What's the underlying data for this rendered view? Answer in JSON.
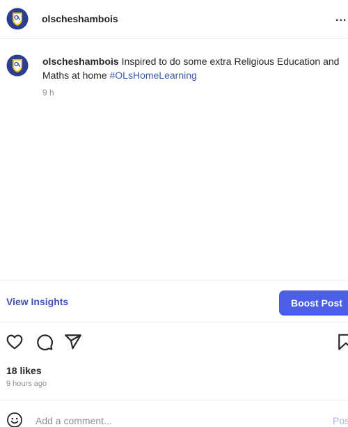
{
  "post": {
    "username": "olscheshambois",
    "more_label": "...",
    "colors": {
      "accent": "#4a5ee8",
      "link": "#3f51b5",
      "hashtag": "#3b5aa8",
      "muted": "#8e8e8e"
    }
  },
  "caption": {
    "username": "olscheshambois",
    "text": " Inspired to do some extra Religious Education and Maths at home ",
    "hashtag": "#OLsHomeLearning",
    "time": "9 h"
  },
  "insights": {
    "view_label": "View Insights",
    "boost_label": "Boost Post"
  },
  "actions": {
    "icons": [
      "heart-icon",
      "comment-icon",
      "share-icon",
      "bookmark-icon"
    ],
    "likes": "18 likes",
    "time_ago": "9 hours ago"
  },
  "comment": {
    "placeholder": "Add a comment...",
    "post_label": "Post"
  }
}
